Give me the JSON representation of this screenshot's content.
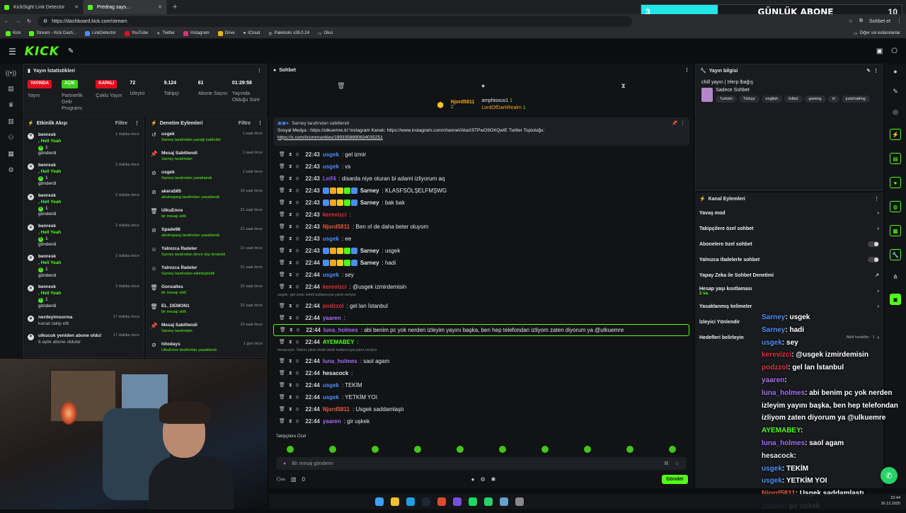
{
  "browser": {
    "tabs": [
      {
        "title": "KickSight Link Detector",
        "active": false
      },
      {
        "title": "Predrag says...",
        "active": true
      }
    ],
    "url": "https://dashboard.kick.com/stream",
    "bookmarks": [
      "Kick",
      "Stream - Kick Dash...",
      "LinkDetector",
      "YouTube",
      "Twitter",
      "Instagram",
      "Drive",
      "iCloud",
      "Paletools v26.0.24",
      "Okul"
    ],
    "other_bookmarks": "Diğer sık kullanılanlar",
    "profile": "Sohbet et"
  },
  "overlay_banner": {
    "left": "3",
    "label": "GÜNLÜK ABONE",
    "count": "10"
  },
  "header": {
    "logo": "KICK"
  },
  "stats": {
    "title": "Yayın İstatistikleri",
    "items": [
      {
        "badge": "YAYINDA",
        "label": "Yayın",
        "color": "#e0101e"
      },
      {
        "badge": "AÇIK",
        "label": "Partnerlik Gelir Programı",
        "color": "#3ccf1a"
      },
      {
        "badge": "KAPALI",
        "label": "Çoklu Yayın",
        "color": "#e0101e"
      },
      {
        "value": "72",
        "label": "İzleyici"
      },
      {
        "value": "9.124",
        "label": "Takipçi"
      },
      {
        "value": "61",
        "label": "Abone Sayısı"
      },
      {
        "value": "01:29:58",
        "label": "Yayında Olduğu Süre"
      }
    ]
  },
  "activity": {
    "title": "Etkinlik Akışı",
    "filter": "Filtre",
    "items": [
      {
        "user": "benresk",
        "line2": ", Hell Yeah",
        "line3": "1",
        "line4": "gönderdi",
        "time": "1 dakika önce"
      },
      {
        "user": "benresk",
        "line2": ", Hell Yeah",
        "line3": "1",
        "line4": "gönderdi",
        "time": "2 dakika önce"
      },
      {
        "user": "benresk",
        "line2": ", Hell Yeah",
        "line3": "1",
        "line4": "gönderdi",
        "time": "2 dakika önce"
      },
      {
        "user": "benresk",
        "line2": ", Hell Yeah",
        "line3": "1",
        "line4": "gönderdi",
        "time": "2 dakika önce"
      },
      {
        "user": "benresk",
        "line2": ", Hell Yeah",
        "line3": "1",
        "line4": "gönderdi",
        "time": "2 dakika önce"
      },
      {
        "user": "benresk",
        "line2": ", Hell Yeah",
        "line3": "1",
        "line4": "gönderdi",
        "time": "3 dakika önce"
      },
      {
        "user": "nerdeyimsorma",
        "line2": "kanalı takip etti",
        "line3": "",
        "line4": "",
        "time": "17 dakika önce"
      },
      {
        "user": "ulkucuk yeniden abone oldu!",
        "line2": "6 aylık abone oldular",
        "line3": "",
        "line4": "",
        "time": "17 dakika önce"
      }
    ]
  },
  "modlog": {
    "title": "Denetim Eylemleri",
    "filter": "Filtre",
    "items": [
      {
        "title": "usgek",
        "sub": "Sarney tarafından yasağı kaldırıldı",
        "time": "1 saat önce"
      },
      {
        "title": "Mesaj Sabitlendi",
        "sub": "Sarney tarafından",
        "time": "1 saat önce"
      },
      {
        "title": "usgek",
        "sub": "Sarney tarafından yasaklandı",
        "time": "1 saat önce"
      },
      {
        "title": "akera585",
        "sub": "alsokegang tarafından yasaklandı",
        "time": "19 saat önce"
      },
      {
        "title": "UlkuEmre",
        "sub": "bir mesajı sildi",
        "time": "21 saat önce"
      },
      {
        "title": "Spade98",
        "sub": "alsokegang tarafından yasaklandı",
        "time": "21 saat önce"
      },
      {
        "title": "Yalnızca İfadeler",
        "sub": "Sarney tarafından devre dışı bırakıldı",
        "time": "21 saat önce"
      },
      {
        "title": "Yalnızca İfadeler",
        "sub": "Sarney tarafından etkinleştirildi",
        "time": "21 saat önce"
      },
      {
        "title": "Gonzalles",
        "sub": "bir mesajı sildi",
        "time": "22 saat önce"
      },
      {
        "title": "EL_DEMON1",
        "sub": "bir mesajı sildi",
        "time": "22 saat önce"
      },
      {
        "title": "Mesaj Sabitlendi",
        "sub": "Sarney tarafından",
        "time": "23 saat önce"
      },
      {
        "title": "hitodays",
        "sub": "UlkuEmre tarafından yasaklandı",
        "time": "1 gün önce"
      }
    ]
  },
  "chat": {
    "title": "Sohbet",
    "top_gifters": [
      {
        "name": "Njord5811",
        "count": "2",
        "rank": "1"
      },
      {
        "name": "amphioxus1",
        "count": "1"
      },
      {
        "name": "LordOfDarkRealm",
        "count": "1"
      }
    ],
    "pinned_by": "Sarney tarafından sabitlendi",
    "pinned_text_1": "Sosyal Medya : https://ulkuemre.tr/ Instagram Kanalı: https://www.instagram.com/channel/AbaX5TPwO9OXQwIE Twitter Topluluğu:",
    "pinned_text_2": "https://x.com/i/communities/1993358890634035251",
    "messages": [
      {
        "time": "22:43",
        "user": "usgek",
        "color": "#4b8df8",
        "text": ": gel izmir"
      },
      {
        "time": "22:43",
        "user": "usgek",
        "color": "#4b8df8",
        "text": ": vs"
      },
      {
        "time": "22:43",
        "user": "Leif4",
        "color": "#8a5cf6",
        "text": ": disarda niye oturan bi adami izliyorum aq"
      },
      {
        "time": "22:43",
        "user": "Sarney",
        "color": "#e8e8e8",
        "text": ": KLASFSÖLŞELFMŞWG",
        "badges": true
      },
      {
        "time": "22:43",
        "user": "Sarney",
        "color": "#e8e8e8",
        "text": ": bak bak",
        "badges": true
      },
      {
        "time": "22:43",
        "user": "kerevizci",
        "color": "#e0303a",
        "text": ":"
      },
      {
        "time": "22:43",
        "user": "Njord5811",
        "color": "#e65a3a",
        "text": ": Ben ırl de daha beter oluyom"
      },
      {
        "time": "22:43",
        "user": "usgek",
        "color": "#4b8df8",
        "text": ": ee"
      },
      {
        "time": "22:43",
        "user": "Sarney",
        "color": "#e8e8e8",
        "text": ": usgek",
        "badges": true
      },
      {
        "time": "22:44",
        "user": "Sarney",
        "color": "#e8e8e8",
        "text": ": hadi",
        "badges": true
      },
      {
        "time": "22:44",
        "user": "usgek",
        "color": "#4b8df8",
        "text": ": sey"
      },
      {
        "time": "22:44",
        "user": "kerevizci",
        "color": "#e0303a",
        "text": ": @usgek izmirdemisin"
      },
      {
        "reply": "usgek: gel izmir isimli kullanıcıya yanıt veriyor"
      },
      {
        "time": "22:44",
        "user": "podzzol",
        "color": "#e0303a",
        "text": ": gel lan İstanbul"
      },
      {
        "time": "22:44",
        "user": "yaaren",
        "color": "#a36cf0",
        "text": ":"
      },
      {
        "time": "22:44",
        "user": "luna_holmes",
        "color": "#a36cf0",
        "text": ": abi benim pc yok nerden izleyim yayını başka, ben hep telefondan izliyom zaten diyorum ya @ulkuemre",
        "hl": true
      },
      {
        "time": "22:44",
        "user": "AYEMABEY",
        "color": "#53fc18",
        "text": ":"
      },
      {
        "reply": "hesacock: Tadını çıkar dostl isimli kullanıcıya yanıt veriyor"
      },
      {
        "time": "22:44",
        "user": "luna_holmes",
        "color": "#a36cf0",
        "text": ": saol agam"
      },
      {
        "time": "22:44",
        "user": "hesacock",
        "color": "#e8e8e8",
        "text": ":"
      },
      {
        "time": "22:44",
        "user": "usgek",
        "color": "#4b8df8",
        "text": ": TEKİM"
      },
      {
        "time": "22:44",
        "user": "usgek",
        "color": "#4b8df8",
        "text": ": YETKİM YOI"
      },
      {
        "time": "22:44",
        "user": "Njord5811",
        "color": "#e65a3a",
        "text": ": Usgek saddamlaştı"
      },
      {
        "time": "22:44",
        "user": "yaaren",
        "color": "#a36cf0",
        "text": ": gir uşkek"
      }
    ],
    "followers_only": "Takipçilere Özel",
    "input_placeholder": "Bir mesaj gönderin",
    "send": "Gönder",
    "footer_count": "0"
  },
  "stream_info": {
    "title": "Yayın bilgisi",
    "stream_title": "chill yayın | Irlerp lbağış",
    "category": "Sadece Sohbet",
    "tags": [
      "Turkish",
      "Türkçe",
      "english",
      "futbol",
      "gaming",
      "irl",
      "justchatting"
    ]
  },
  "channel_actions": {
    "title": "Kanal Eylemleri",
    "items": [
      {
        "label": "Yavaş mod",
        "kind": "arrow"
      },
      {
        "label": "Takipçilere özel sohbet",
        "kind": "arrow"
      },
      {
        "label": "Abonelere özel sohbet",
        "kind": "toggle"
      },
      {
        "label": "Yalnızca ifadelerle sohbet",
        "kind": "toggle"
      },
      {
        "label": "Yapay Zeka ile Sohbet Denetimi",
        "kind": "link"
      },
      {
        "label": "Hesap yaşı kısıtlaması",
        "sub": "2 sa.",
        "kind": "arrow"
      },
      {
        "label": "Yasaklanmış kelimeler",
        "kind": "arrow"
      },
      {
        "label": "İzleyici Yönlendir",
        "kind": "none"
      },
      {
        "label": "Hedefleri belirleyin",
        "sub2": "Aktif hedefler · 1",
        "kind": "arrow"
      }
    ]
  },
  "overlay_chat": [
    {
      "user": "Sarney",
      "color": "#4b8df8",
      "text": ": usgek"
    },
    {
      "user": "Sarney",
      "color": "#4b8df8",
      "text": ": hadi"
    },
    {
      "user": "usgek",
      "color": "#4b8df8",
      "text": ": sey"
    },
    {
      "user": "kerevizci",
      "color": "#e0303a",
      "text": ": @usgek izmirdemisin"
    },
    {
      "user": "podzzol",
      "color": "#e0303a",
      "text": ": gel lan İstanbul"
    },
    {
      "user": "yaaren",
      "color": "#a36cf0",
      "text": ":"
    },
    {
      "user": "luna_holmes",
      "color": "#a36cf0",
      "text": ": abi benim pc yok nerden izleyim yayını başka, ben hep telefondan izliyom zaten diyorum ya @ulkuemre"
    },
    {
      "user": "AYEMABEY",
      "color": "#53fc18",
      "text": ":"
    },
    {
      "user": "luna_holmes",
      "color": "#a36cf0",
      "text": ": saol agam"
    },
    {
      "user": "hesacock",
      "color": "#e8e8e8",
      "text": ":"
    },
    {
      "user": "usgek",
      "color": "#4b8df8",
      "text": ": TEKİM"
    },
    {
      "user": "usgek",
      "color": "#4b8df8",
      "text": ": YETKİM YOI"
    },
    {
      "user": "Njord5811",
      "color": "#e65a3a",
      "text": ": Usgek saddamlaştı"
    },
    {
      "user": "yaaren",
      "color": "#a36cf0",
      "text": ": gir uşkek"
    }
  ],
  "clock": {
    "time": "22:44",
    "date": "26.12.2025"
  }
}
